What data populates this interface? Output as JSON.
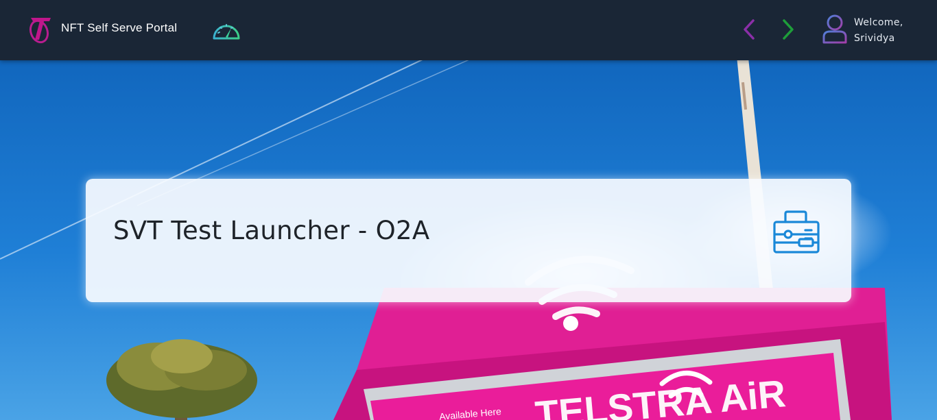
{
  "header": {
    "app_title": "NFT Self Serve Portal",
    "logo_icon": "telstra-t-logo-icon",
    "dashboard_icon": "speedometer-icon",
    "back_icon": "chevron-left-icon",
    "forward_icon": "chevron-right-icon",
    "user_icon": "user-avatar-icon",
    "welcome_label": "Welcome,",
    "user_name": "Srividya"
  },
  "card": {
    "title": "SVT Test Launcher - O2A",
    "icon": "toolbox-icon"
  },
  "background": {
    "sign_caption": "Available Here",
    "sign_brand": "TELSTRA AiR"
  },
  "colors": {
    "header_bg": "#1a2636",
    "brand_magenta": "#d1118a",
    "back_arrow": "#8b2fa8",
    "forward_arrow": "#1e9e3a",
    "card_icon": "#1a88d8"
  }
}
